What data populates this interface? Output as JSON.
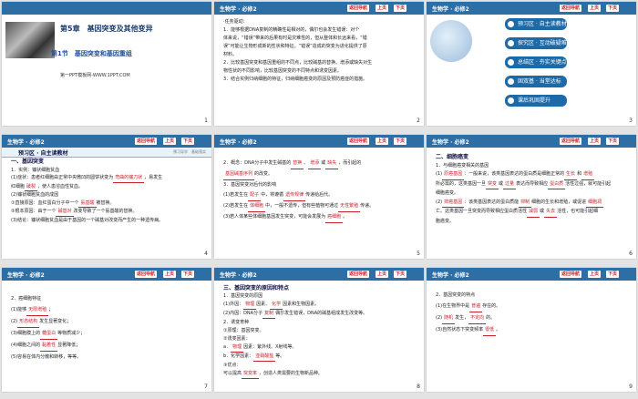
{
  "header": {
    "subject": "生物学 · 必修2",
    "nav": "返回导航",
    "prev": "上页",
    "next": "下页"
  },
  "s1": {
    "chapter": "第5章　基因突变及其他变异",
    "section": "第1节　基因突变和基因重组",
    "site": "第一PPT模板网-WWW.1PPT.COM",
    "page": "1"
  },
  "s2": {
    "page": "2",
    "lines": [
      "·任务驱动：",
      "1．能够根据DNA复制的精确性是相对的，偶尔也会发生错误：对个",
      "体来说，“错误”带来的后果有时是灾难性的，但从整体和长远来看，“错",
      "误”可能让生物形成新的性状和特征。“错误”造成的突变为进化提供了原",
      "材料。",
      "2．比较基因突变和基因重组的不同点，比较碱基的替换、增添或缺失对生",
      "物性状的不同影响，比较基因突变的不同特点和诱变因素。",
      "3．结合实例归纳细胞的特征，归纳细胞癌变的原因及预防癌症的措施。"
    ]
  },
  "s3": {
    "page": "3",
    "menu": [
      "预习区 · 自主读教材",
      "探究区 · 互动破疑难",
      "总结区 · 夯实关键点",
      "固双基 · 当堂达标",
      "课后巩固提升"
    ]
  },
  "s4": {
    "page": "4",
    "title": "预习区 · 自主读教材",
    "title_right": "预习导学　基础落实",
    "sect": "一、基因突变",
    "l1": "1．实例：镰状细胞贫血",
    "l2a": "(1)症状：患者红细胞由正常中央微凹的圆饼状变为",
    "b1": "弯曲的镰刀状",
    "l2b": "，易发生",
    "l3a": "红细胞",
    "b2": "破裂",
    "l3b": "，使人患溶血性贫血。",
    "l4": "(2)镰状细胞贫血的成因",
    "l5a": "①直接原因：血红蛋白分子中一个",
    "b3": "氨基酸",
    "l5b": "被替换。",
    "l6a": "②根本原因：由于一个",
    "b4": "碱基对",
    "l6b": "改变导致了一个氨基酸的替换。",
    "l7": "(3)结论：镰状细胞贫血是由于基因的一个碱基对改变而产生的一种遗传病。"
  },
  "s5": {
    "page": "5",
    "l1a": "2．概念：DNA分子中发生碱基的",
    "b1": "替换",
    "b2": "增添",
    "l1b": "或",
    "b3": "缺失",
    "l1c": "，而引起的",
    "b4": "基因碱基序列",
    "l2": "的改变。",
    "l3": "3．基因突变对后代的影响",
    "l4a": "(1)若发生在",
    "b5": "配子",
    "l4b": "中，将遵循",
    "b6": "遗传规律",
    "l4c": "传递给后代。",
    "l5a": "(2)若发生在",
    "b7": "体细胞",
    "l5b": "中，一般不遗传，但有些植物可通过",
    "b8": "无性繁殖",
    "l5c": "传递。",
    "l6a": "(3)若人体某些体细胞基因发生突变，可能会发展为",
    "b9": "癌细胞",
    "l6b": "。"
  },
  "s6": {
    "page": "6",
    "sect": "二、细胞癌变",
    "l1": "1．与细胞癌变相关的基因",
    "l2a": "(1)",
    "b1": "原癌基因",
    "l2b": "：一般来说，该类基因表达的蛋白质是细胞正常的",
    "b2": "生长",
    "l2c": "和",
    "b3": "增殖",
    "l3": "所必需的，这类基因一旦",
    "b4": "突变",
    "l3b": "或",
    "b5": "过量",
    "l3c": "表达而导致相应",
    "b6": "蛋白质",
    "l3d": "活性过强，就可能引起",
    "l4": "细胞癌变。",
    "l5a": "(2)",
    "b7": "抑癌基因",
    "l5b": "：该类基因表达的蛋白质能",
    "b8": "抑制",
    "l5c": "细胞的生长和增殖，或促进",
    "b9": "细胞凋",
    "l6a": "亡",
    "l6b": "。这类基因一旦突变而导致相应蛋白质活性",
    "b10": "减弱",
    "l6c": "或",
    "b11": "失去",
    "l6d": "活性，也可能引起细",
    "l7": "胞癌变。"
  },
  "s7": {
    "page": "7",
    "l1": "2．癌细胞特征",
    "l2a": "(1)能够",
    "b1": "无限增殖",
    "l2b": "；",
    "l3a": "(2)",
    "b2": "形态结构",
    "l3b": "发生显著变化；",
    "l4a": "(3)细胞膜上的",
    "b3": "糖蛋白",
    "l4b": "等物质减少；",
    "l5a": "(4)细胞之间的",
    "b4": "黏着性",
    "l5b": "显著降低；",
    "l6": "(5)容易在体内分散和转移，等等。"
  },
  "s8": {
    "page": "8",
    "sect": "三、基因突变的原因和特点",
    "l1": "1．基因突变的原因",
    "l2a": "(1)外因：",
    "b1": "物理",
    "l2b": "因素、",
    "b2": "化学",
    "l2c": "因素和生物因素。",
    "l3a": "(2)内因：DNA分子",
    "b3": "复制",
    "l3b": "偶尔发生错误，DNA的碱基组成发生改变等。",
    "l4": "2．诱变育种",
    "l5": "①原理：基因突变。",
    "l6": "②诱变因素：",
    "l7a": "a．",
    "b4": "物理",
    "l7b": "因素：紫外线、X射线等。",
    "l8a": "b．化学因素：",
    "b5": "亚硝酸盐",
    "l8b": "等。",
    "l9": "③优点：",
    "l10a": "可以提高",
    "b6": "突变率",
    "l10b": "，创造人类需要的生物新品种。"
  },
  "s9": {
    "page": "9",
    "l1": "2．基因突变的特点",
    "l2a": "(1)在生物界中是",
    "b1": "普遍",
    "l2b": "存在的。",
    "l3a": "(2)",
    "b2": "随机",
    "l3b": "发生，",
    "b3": "不定向",
    "l3c": "的。",
    "l4": "(3)自然状态下突变频率",
    "b4": "很低",
    "l4b": "。"
  }
}
